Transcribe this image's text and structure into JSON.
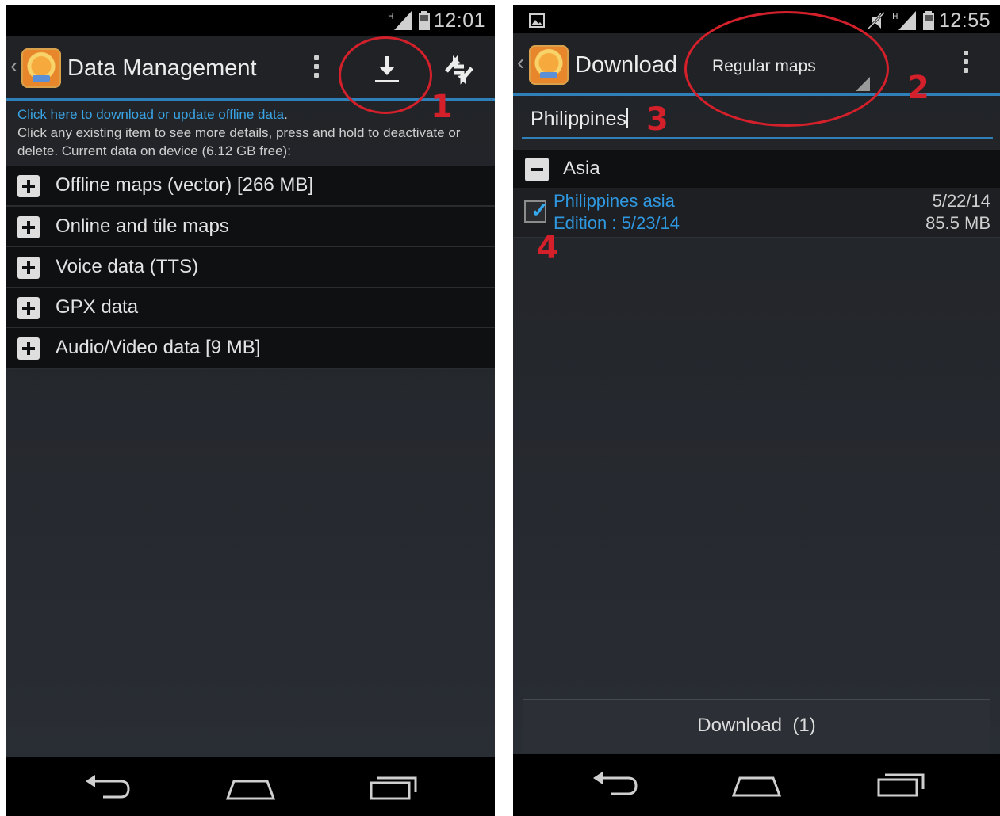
{
  "left_screen": {
    "status_time": "12:01",
    "title": "Data Management",
    "info_link": "Click here to download or update offline data",
    "info_text": "Click any existing item to see more details, press and hold to deactivate or delete. Current data on device (6.12 GB free):",
    "categories": [
      "Offline maps (vector) [266 MB]",
      "Online and tile maps",
      "Voice data (TTS)",
      "GPX data",
      "Audio/Video data [9 MB]"
    ],
    "annotation": "1",
    "icons": [
      "overflow-icon",
      "download-icon",
      "sync-icon"
    ]
  },
  "right_screen": {
    "status_time": "12:55",
    "title": "Download",
    "map_type": "Regular maps",
    "search_value": "Philippines",
    "group": "Asia",
    "item": {
      "name": "Philippines asia",
      "edition": "Edition : 5/23/14",
      "date": "5/22/14",
      "size": "85.5 MB",
      "checked": true
    },
    "download_button": "Download  (1)",
    "annotations": [
      "2",
      "3",
      "4"
    ]
  },
  "colors": {
    "accent": "#2f7fb8",
    "link": "#3aa3e3",
    "annotation": "#d3202a"
  }
}
